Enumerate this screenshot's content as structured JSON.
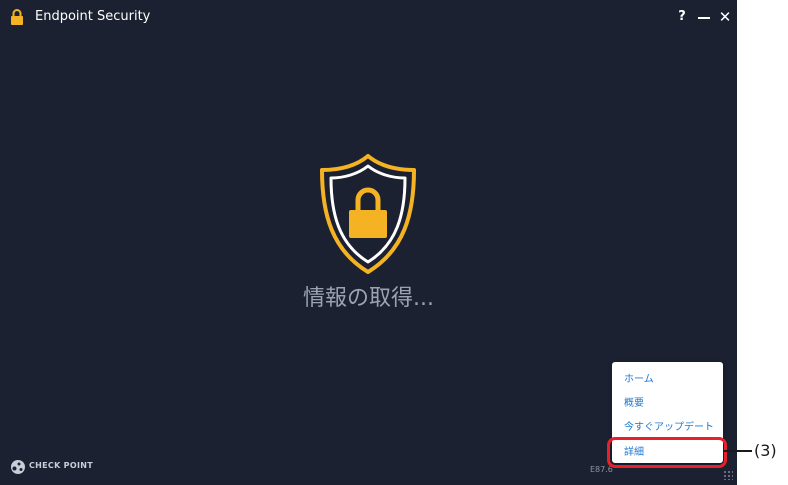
{
  "window": {
    "title": "Endpoint Security",
    "help_label": "?",
    "close_label": "✕"
  },
  "main": {
    "status": "情報の取得..."
  },
  "footer": {
    "brand": "CHECK POINT",
    "version": "E87.6"
  },
  "menu": {
    "items": [
      {
        "label": "ホーム"
      },
      {
        "label": "概要"
      },
      {
        "label": "今すぐアップデート"
      },
      {
        "label": "詳細"
      }
    ]
  },
  "annotation": {
    "label": "(3)"
  },
  "colors": {
    "background": "#1b2130",
    "accent_yellow": "#f5b324",
    "menu_link": "#1f78d1",
    "highlight": "#e8202b"
  },
  "icons": {
    "title_icon": "lock-icon",
    "center_icon": "shield-lock-icon",
    "brand_icon": "check-point-logo"
  }
}
